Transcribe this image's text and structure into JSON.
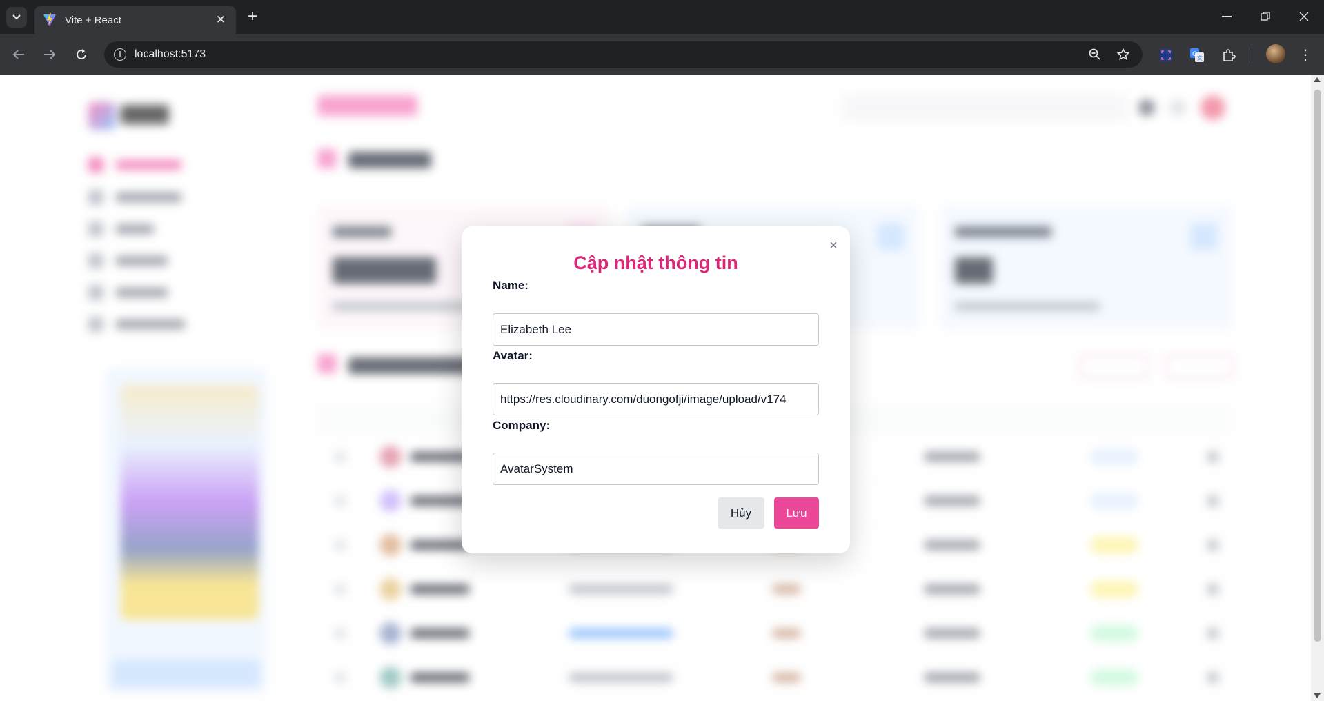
{
  "browser": {
    "tab_title": "Vite + React",
    "url": "localhost:5173",
    "accent": "#35363a"
  },
  "modal": {
    "title": "Cập nhật thông tin",
    "close_glyph": "×",
    "fields": {
      "name_label": "Name:",
      "name_value": "Elizabeth Lee",
      "avatar_label": "Avatar:",
      "avatar_value": "https://res.cloudinary.com/duongofji/image/upload/v174",
      "company_label": "Company:",
      "company_value": "AvatarSystem"
    },
    "cancel_label": "Hủy",
    "save_label": "Lưu",
    "title_color": "#db2777",
    "save_color": "#ec4899"
  }
}
